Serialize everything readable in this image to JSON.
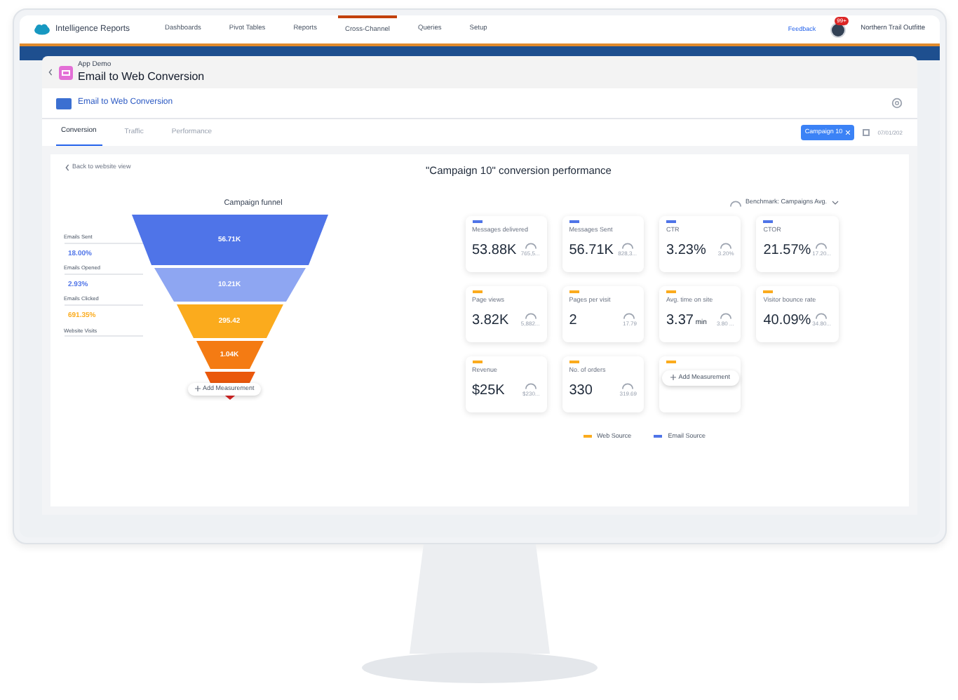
{
  "nav": {
    "app_name": "Intelligence Reports",
    "tabs": [
      {
        "label": "Dashboards",
        "selected": false
      },
      {
        "label": "Pivot Tables",
        "selected": false
      },
      {
        "label": "Reports",
        "selected": false
      },
      {
        "label": "Cross-Channel",
        "selected": true
      },
      {
        "label": "Queries",
        "selected": false
      },
      {
        "label": "Setup",
        "selected": false
      }
    ],
    "feedback": "Feedback",
    "notification_badge": "99+",
    "org": "Northern Trail Outfitte"
  },
  "page_header": {
    "subtitle": "App Demo",
    "title": "Email to Web Conversion"
  },
  "report": {
    "title": "Email to Web Conversion",
    "tabs": [
      {
        "label": "Conversion",
        "selected": true
      },
      {
        "label": "Traffic",
        "selected": false
      },
      {
        "label": "Performance",
        "selected": false
      }
    ],
    "filter_chip": "Campaign 10",
    "date": "07/01/202"
  },
  "back_link": "Back to website view",
  "funnel": {
    "title": "Campaign funnel",
    "stages": [
      {
        "label": "Emails Sent",
        "value": "56.71K",
        "color": "#4f74e8"
      },
      {
        "label": "Emails Opened",
        "value": "10.21K",
        "color": "#8ea6f2"
      },
      {
        "label": "Emails Clicked",
        "value": "295.42",
        "color": "#fbab1d"
      },
      {
        "label": "Website Visits",
        "value": "1.04K",
        "color": "#f47b13"
      }
    ],
    "rates": [
      {
        "text": "18.00%",
        "color": "#4f74e8"
      },
      {
        "text": "2.93%",
        "color": "#4f74e8"
      },
      {
        "text": "691.35%",
        "color": "#fbab1d"
      }
    ],
    "add_button": "Add Measurement"
  },
  "performance": {
    "title": "\"Campaign 10\" conversion performance",
    "benchmark": "Benchmark: Campaigns Avg.",
    "cards": [
      {
        "kind": "metric",
        "color": "#4f74e8",
        "label": "Messages delivered",
        "value": "53.88K",
        "benchmark": "765,5..."
      },
      {
        "kind": "metric",
        "color": "#4f74e8",
        "label": "Messages Sent",
        "value": "56.71K",
        "benchmark": "828,3..."
      },
      {
        "kind": "metric",
        "color": "#4f74e8",
        "label": "CTR",
        "value": "3.23%",
        "benchmark": "3.20%"
      },
      {
        "kind": "metric",
        "color": "#4f74e8",
        "label": "CTOR",
        "value": "21.57%",
        "benchmark": "17.20..."
      },
      {
        "kind": "metric",
        "color": "#fbab1d",
        "label": "Page views",
        "value": "3.82K",
        "benchmark": "5,882..."
      },
      {
        "kind": "metric",
        "color": "#fbab1d",
        "label": "Pages per visit",
        "value": "2",
        "benchmark": "17.79"
      },
      {
        "kind": "metric",
        "color": "#fbab1d",
        "label": "Avg. time on site",
        "value": "3.37",
        "unit": "min",
        "benchmark": "3.80 ..."
      },
      {
        "kind": "metric",
        "color": "#fbab1d",
        "label": "Visitor bounce rate",
        "value": "40.09%",
        "benchmark": "34.80..."
      },
      {
        "kind": "metric",
        "color": "#fbab1d",
        "label": "Revenue",
        "value": "$25K",
        "benchmark": "$230..."
      },
      {
        "kind": "metric",
        "color": "#fbab1d",
        "label": "No. of orders",
        "value": "330",
        "benchmark": "319.69"
      },
      {
        "kind": "add",
        "color": "#fbab1d",
        "label": "Add Measurement"
      }
    ],
    "legend": [
      {
        "label": "Web Source",
        "color": "#fbab1d"
      },
      {
        "label": "Email Source",
        "color": "#4f74e8"
      }
    ]
  }
}
